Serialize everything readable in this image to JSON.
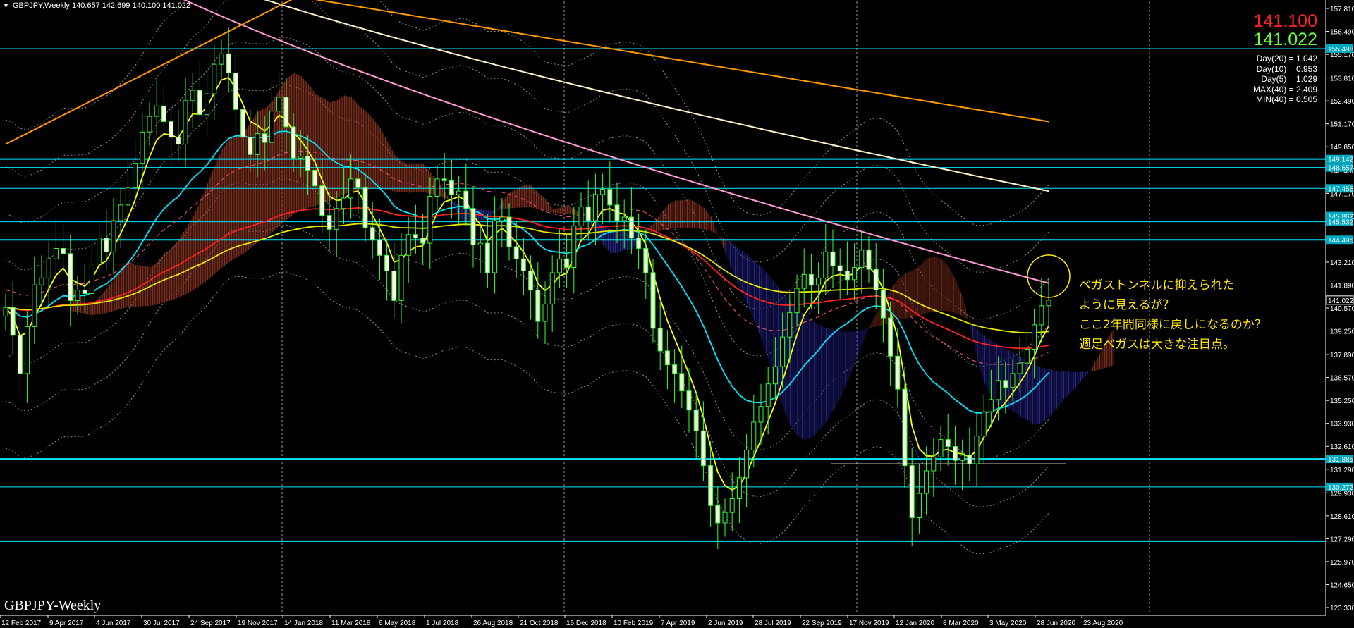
{
  "header": {
    "symbol": "GBPJPY,Weekly",
    "ohlc": "140.657 142.699 140.100 141.022"
  },
  "price_panel": {
    "ask": "141.100",
    "bid": "141.022",
    "ask_color": "#ff2020",
    "bid_color": "#66ff33",
    "stats": [
      "Day(20) = 1.042",
      "Day(10) = 0.953",
      "Day(5) = 1.029",
      "MAX(40) = 2.409",
      "MIN(40) = 0.505"
    ]
  },
  "annotation": {
    "lines": [
      "ベガストンネルに抑えられた",
      "ように見えるが？",
      "ここ2年間同様に戻しになるのか？",
      "週足ベガスは大きな注目点。"
    ],
    "color": "#ffe600"
  },
  "watermark": "GBPJPY-Weekly",
  "chart_data": {
    "type": "line",
    "symbol": "GBPJPY",
    "timeframe": "Weekly",
    "x_labels": [
      "12 Feb 2017",
      "9 Apr 2017",
      "4 Jun 2017",
      "30 Jul 2017",
      "24 Sep 2017",
      "19 Nov 2017",
      "14 Jan 2018",
      "11 Mar 2018",
      "6 May 2018",
      "1 Jul 2018",
      "26 Aug 2018",
      "21 Oct 2018",
      "16 Dec 2018",
      "10 Feb 2019",
      "7 Apr 2019",
      "2 Jun 2019",
      "28 Jul 2019",
      "22 Sep 2019",
      "17 Nov 2019",
      "12 Jan 2020",
      "8 Mar 2020",
      "3 May 2020",
      "28 Jun 2020",
      "23 Aug 2020"
    ],
    "y_ticks": [
      "157.810",
      "156.490",
      "155.170",
      "153.810",
      "152.490",
      "151.170",
      "149.850",
      "148.490",
      "147.170",
      "145.850",
      "144.490",
      "143.210",
      "141.890",
      "140.570",
      "139.250",
      "137.890",
      "136.570",
      "135.250",
      "133.930",
      "132.610",
      "131.290",
      "129.930",
      "128.610",
      "127.290",
      "125.970",
      "124.650",
      "123.330"
    ],
    "ylim": [
      123.33,
      157.81
    ],
    "price_labels": [
      {
        "value": 155.498,
        "text": "155.498",
        "color": "#00e5ff"
      },
      {
        "value": 149.142,
        "text": "149.142",
        "color": "#00e5ff"
      },
      {
        "value": 148.657,
        "text": "148.657",
        "color": "#00e5ff"
      },
      {
        "value": 147.455,
        "text": "147.455",
        "color": "#00e5ff"
      },
      {
        "value": 145.862,
        "text": "145.862",
        "color": "#00e5ff"
      },
      {
        "value": 145.532,
        "text": "145.532",
        "color": "#00e5ff"
      },
      {
        "value": 144.495,
        "text": "144.495",
        "color": "#00e5ff"
      },
      {
        "value": 141.022,
        "text": "141.022",
        "color": "#ffffff"
      },
      {
        "value": 131.885,
        "text": "131.885",
        "color": "#00e5ff"
      },
      {
        "value": 130.272,
        "text": "130.272",
        "color": "#00e5ff"
      }
    ],
    "horizontal_levels": [
      155.498,
      149.142,
      148.657,
      147.455,
      145.862,
      145.532,
      144.495,
      131.885,
      130.272,
      127.15
    ],
    "candles_close": [
      140.6,
      139.0,
      136.8,
      139.5,
      141.9,
      142.3,
      143.4,
      144.0,
      143.7,
      141.0,
      141.6,
      141.4,
      143.1,
      144.6,
      143.8,
      145.6,
      146.5,
      147.5,
      148.9,
      150.7,
      151.6,
      152.2,
      151.3,
      150.4,
      150.0,
      152.5,
      153.1,
      151.7,
      152.9,
      154.6,
      155.2,
      154.1,
      152.0,
      150.4,
      149.4,
      150.6,
      150.1,
      151.9,
      152.7,
      151.0,
      149.2,
      149.3,
      148.5,
      147.6,
      145.9,
      145.1,
      146.3,
      146.9,
      148.0,
      147.5,
      145.2,
      144.5,
      143.6,
      142.7,
      141.0,
      143.6,
      144.8,
      144.6,
      144.3,
      147.0,
      148.0,
      147.9,
      147.1,
      147.3,
      146.3,
      144.2,
      144.3,
      142.6,
      145.6,
      145.8,
      144.1,
      143.4,
      142.7,
      141.6,
      139.8,
      140.8,
      142.6,
      143.4,
      142.9,
      145.3,
      146.4,
      145.6,
      147.1,
      147.4,
      146.5,
      145.6,
      145.8,
      144.6,
      144.0,
      142.6,
      139.4,
      138.1,
      137.3,
      136.8,
      135.8,
      134.7,
      133.5,
      131.5,
      129.2,
      128.2,
      128.8,
      129.6,
      130.8,
      132.4,
      134.0,
      134.9,
      136.2,
      137.2,
      138.9,
      140.3,
      141.7,
      142.5,
      141.9,
      142.3,
      143.8,
      143.0,
      142.7,
      142.2,
      142.9,
      143.9,
      142.8,
      141.6,
      140.0,
      137.8,
      135.9,
      131.5,
      128.5,
      129.9,
      131.2,
      132.0,
      133.0,
      132.6,
      131.8,
      132.1,
      131.6,
      133.2,
      134.6,
      135.3,
      136.4,
      136.0,
      136.8,
      137.4,
      138.2,
      139.6,
      140.7,
      141.02
    ],
    "series": [
      {
        "name": "EMA5",
        "color": "#ffff00"
      },
      {
        "name": "EMA20",
        "color": "#00e5ff"
      },
      {
        "name": "EMA75",
        "color": "#ff2020"
      },
      {
        "name": "EMA100",
        "color": "#e6e600"
      },
      {
        "name": "EMA200",
        "color": "#ff9ad6"
      },
      {
        "name": "EMA300",
        "color": "#fff2c8"
      },
      {
        "name": "EMA800",
        "color": "#ff9900"
      }
    ],
    "circle_highlight": {
      "x_label": "23 Aug 2020",
      "y": 142.4
    }
  }
}
